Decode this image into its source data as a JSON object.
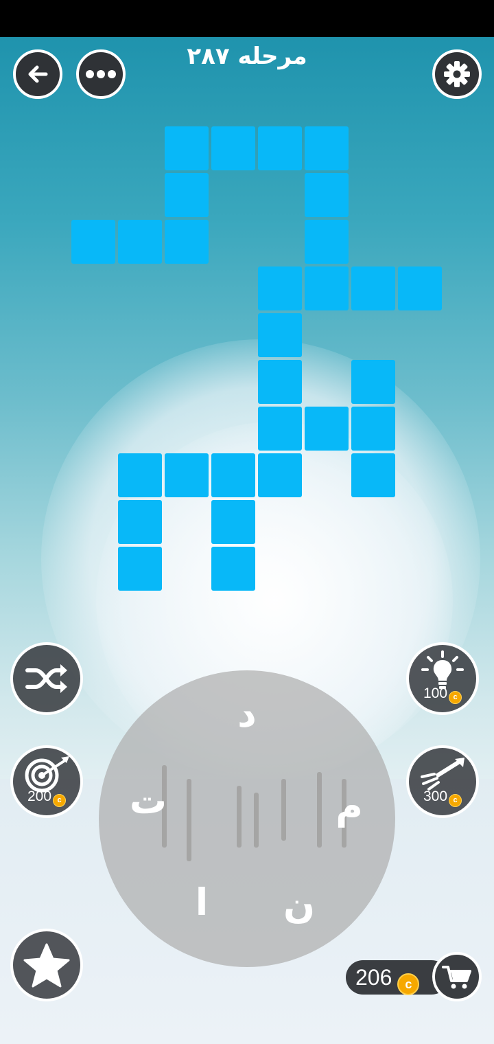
{
  "header": {
    "title": "مرحله ۲۸۷",
    "back_icon": "arrow-left-icon",
    "menu_icon": "more-dots-icon",
    "settings_icon": "gear-icon"
  },
  "grid": {
    "cell_color": "#08b8f8"
  },
  "wheel": {
    "letters": [
      "د",
      "م",
      "ن",
      "ا",
      "ت"
    ]
  },
  "tools": {
    "shuffle": {
      "icon": "shuffle-icon"
    },
    "hint": {
      "icon": "lightbulb-icon",
      "cost": "100"
    },
    "target": {
      "icon": "target-icon",
      "cost": "200"
    },
    "rocket": {
      "icon": "rocket-icon",
      "cost": "300"
    },
    "favorite": {
      "icon": "star-icon"
    }
  },
  "wallet": {
    "coins": "206",
    "cart_icon": "shopping-cart-icon",
    "coin_symbol": "c"
  }
}
